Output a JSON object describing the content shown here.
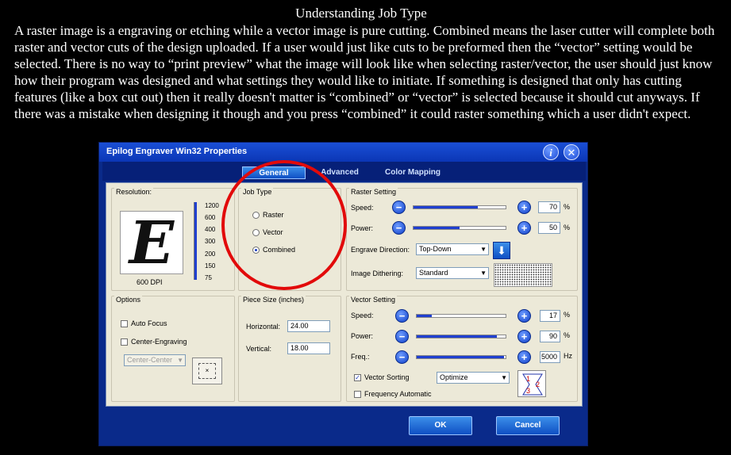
{
  "heading": "Understanding Job Type",
  "paragraph": "A raster image is a engraving or etching while a vector image is pure cutting. Combined means the laser cutter will complete both raster and vector cuts of the design uploaded. If a user would just like cuts to be preformed then the “vector” setting would be selected. There is no way to “print preview” what the image will look like when selecting raster/vector, the user should just know how their program was designed and what settings they would like to initiate. If something is designed  that only has cutting features (like a box cut out) then it really doesn't matter is “combined” or “vector” is selected because it should cut anyways. If there was a mistake when designing it though and you press “combined” it could raster something which a user didn't expect.",
  "dialog": {
    "title": "Epilog Engraver Win32 Properties",
    "help_glyph": "i",
    "close_glyph": "✕",
    "tabs": [
      {
        "label": "General",
        "active": true
      },
      {
        "label": "Advanced",
        "active": false
      },
      {
        "label": "Color Mapping",
        "active": false
      }
    ],
    "resolution": {
      "label": "Resolution:",
      "preview_letter": "E",
      "current": "600 DPI",
      "ticks": [
        "1200",
        "600",
        "400",
        "300",
        "200",
        "150",
        "75"
      ]
    },
    "job_type": {
      "label": "Job Type",
      "options": [
        "Raster",
        "Vector",
        "Combined"
      ],
      "selected": "Combined"
    },
    "raster": {
      "label": "Raster Setting",
      "speed_label": "Speed:",
      "speed_value": "70",
      "speed_level": 0.7,
      "power_label": "Power:",
      "power_value": "50",
      "power_level": 0.5,
      "unit": "%",
      "direction_label": "Engrave Direction:",
      "direction_value": "Top-Down",
      "dithering_label": "Image Dithering:",
      "dithering_value": "Standard"
    },
    "options": {
      "label": "Options",
      "auto_focus": "Auto Focus",
      "center_engraving": "Center-Engraving",
      "center_mode": "Center-Center"
    },
    "piece_size": {
      "label": "Piece Size (inches)",
      "horizontal_label": "Horizontal:",
      "horizontal_value": "24.00",
      "vertical_label": "Vertical:",
      "vertical_value": "18.00"
    },
    "vector": {
      "label": "Vector Setting",
      "speed_label": "Speed:",
      "speed_value": "17",
      "speed_level": 0.17,
      "power_label": "Power:",
      "power_value": "90",
      "power_level": 0.9,
      "freq_label": "Freq.:",
      "freq_value": "5000",
      "freq_level": 0.98,
      "unit": "%",
      "freq_unit": "Hz",
      "vector_sorting": "Vector Sorting",
      "vector_sorting_checked": true,
      "sorting_mode": "Optimize",
      "frequency_automatic": "Frequency Automatic"
    },
    "ok_label": "OK",
    "cancel_label": "Cancel"
  }
}
